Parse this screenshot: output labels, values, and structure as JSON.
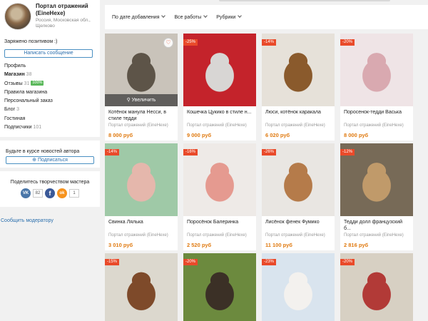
{
  "shop": {
    "name": "Портал отражений (EineHexe)",
    "location": "Россия, Московская обл., Щелково",
    "status": "Заряжено позитивом :)",
    "message_button": "Написать сообщение",
    "menu": [
      {
        "label": "Профиль",
        "count": ""
      },
      {
        "label": "Магазин",
        "count": "38"
      },
      {
        "label": "Отзывы",
        "count": "31",
        "badge": "100%"
      },
      {
        "label": "Правила магазина",
        "count": ""
      },
      {
        "label": "Персональный заказ",
        "count": ""
      },
      {
        "label": "Блог",
        "count": "3"
      },
      {
        "label": "Гостиная",
        "count": ""
      },
      {
        "label": "Подписчики",
        "count": "101"
      }
    ]
  },
  "subscribe": {
    "title": "Будьте в курсе новостей автора",
    "button": "Подписаться"
  },
  "share": {
    "title": "Поделитесь творчеством мастера",
    "vk_label": "VK",
    "vk_count": "82",
    "fb_label": "f",
    "ok_label": "ok",
    "ok_count": "1"
  },
  "report_link": "Сообщить модератору",
  "filters": {
    "sort": "По дате добавления",
    "works": "Все работы",
    "rubrics": "Рубрики"
  },
  "products": [
    {
      "title": "Котёнок манула Несси, в стиле тедди",
      "shop": "Портал отражений (EineHexe)",
      "price": "8 000 руб",
      "discount": "",
      "hovered": true,
      "zoom_label": "Увеличить",
      "colors": [
        "#c9c3ba",
        "#5d5448"
      ]
    },
    {
      "title": "Кошечка Цукико в стиле н...",
      "shop": "Портал отражений (EineHexe)",
      "price": "9 000 руб",
      "discount": "-25%",
      "colors": [
        "#c4232b",
        "#d8d6d4"
      ]
    },
    {
      "title": "Люси, котёнок каракала",
      "shop": "Портал отражений (EineHexe)",
      "price": "6 020 руб",
      "discount": "-14%",
      "colors": [
        "#e6e1d9",
        "#8a5a2c"
      ]
    },
    {
      "title": "Поросенок-тедди Васька",
      "shop": "Портал отражений (EineHexe)",
      "price": "8 000 руб",
      "discount": "-20%",
      "colors": [
        "#efe4e6",
        "#d9a9b0"
      ]
    },
    {
      "title": "Свинка Лялька",
      "shop": "Портал отражений (EineHexe)",
      "price": "3 010 руб",
      "discount": "-14%",
      "colors": [
        "#9fc9a7",
        "#e5b7ac"
      ]
    },
    {
      "title": "Поросёнок Балеринка",
      "shop": "Портал отражений (EineHexe)",
      "price": "2 520 руб",
      "discount": "-16%",
      "colors": [
        "#eeeae7",
        "#e59a90"
      ]
    },
    {
      "title": "Лисёнок фенек Фумико",
      "shop": "Портал отражений (EineHexe)",
      "price": "11 100 руб",
      "discount": "-26%",
      "colors": [
        "#e9e6e2",
        "#b57b4a"
      ]
    },
    {
      "title": "Тедди долл французский б...",
      "shop": "Портал отражений (EineHexe)",
      "price": "2 816 руб",
      "discount": "-12%",
      "colors": [
        "#776a57",
        "#c09a6a"
      ]
    },
    {
      "title": "",
      "shop": "",
      "price": "",
      "discount": "-15%",
      "colors": [
        "#dcd8ce",
        "#7e4a2a"
      ]
    },
    {
      "title": "",
      "shop": "",
      "price": "",
      "discount": "-20%",
      "colors": [
        "#6c8a3e",
        "#3b3026"
      ]
    },
    {
      "title": "",
      "shop": "",
      "price": "",
      "discount": "-23%",
      "colors": [
        "#d9e4ee",
        "#f3f1ee"
      ]
    },
    {
      "title": "",
      "shop": "",
      "price": "",
      "discount": "-20%",
      "colors": [
        "#d7d0c3",
        "#b23a37"
      ]
    }
  ]
}
